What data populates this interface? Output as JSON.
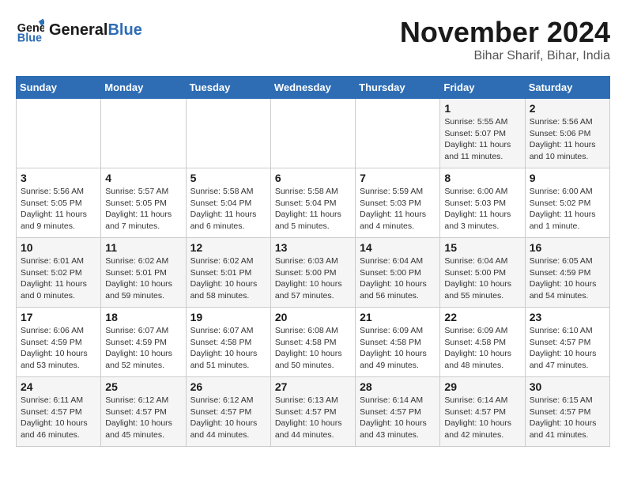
{
  "header": {
    "logo_line1": "General",
    "logo_line2": "Blue",
    "month_title": "November 2024",
    "location": "Bihar Sharif, Bihar, India"
  },
  "weekdays": [
    "Sunday",
    "Monday",
    "Tuesday",
    "Wednesday",
    "Thursday",
    "Friday",
    "Saturday"
  ],
  "weeks": [
    [
      {
        "day": "",
        "detail": ""
      },
      {
        "day": "",
        "detail": ""
      },
      {
        "day": "",
        "detail": ""
      },
      {
        "day": "",
        "detail": ""
      },
      {
        "day": "",
        "detail": ""
      },
      {
        "day": "1",
        "detail": "Sunrise: 5:55 AM\nSunset: 5:07 PM\nDaylight: 11 hours and 11 minutes."
      },
      {
        "day": "2",
        "detail": "Sunrise: 5:56 AM\nSunset: 5:06 PM\nDaylight: 11 hours and 10 minutes."
      }
    ],
    [
      {
        "day": "3",
        "detail": "Sunrise: 5:56 AM\nSunset: 5:05 PM\nDaylight: 11 hours and 9 minutes."
      },
      {
        "day": "4",
        "detail": "Sunrise: 5:57 AM\nSunset: 5:05 PM\nDaylight: 11 hours and 7 minutes."
      },
      {
        "day": "5",
        "detail": "Sunrise: 5:58 AM\nSunset: 5:04 PM\nDaylight: 11 hours and 6 minutes."
      },
      {
        "day": "6",
        "detail": "Sunrise: 5:58 AM\nSunset: 5:04 PM\nDaylight: 11 hours and 5 minutes."
      },
      {
        "day": "7",
        "detail": "Sunrise: 5:59 AM\nSunset: 5:03 PM\nDaylight: 11 hours and 4 minutes."
      },
      {
        "day": "8",
        "detail": "Sunrise: 6:00 AM\nSunset: 5:03 PM\nDaylight: 11 hours and 3 minutes."
      },
      {
        "day": "9",
        "detail": "Sunrise: 6:00 AM\nSunset: 5:02 PM\nDaylight: 11 hours and 1 minute."
      }
    ],
    [
      {
        "day": "10",
        "detail": "Sunrise: 6:01 AM\nSunset: 5:02 PM\nDaylight: 11 hours and 0 minutes."
      },
      {
        "day": "11",
        "detail": "Sunrise: 6:02 AM\nSunset: 5:01 PM\nDaylight: 10 hours and 59 minutes."
      },
      {
        "day": "12",
        "detail": "Sunrise: 6:02 AM\nSunset: 5:01 PM\nDaylight: 10 hours and 58 minutes."
      },
      {
        "day": "13",
        "detail": "Sunrise: 6:03 AM\nSunset: 5:00 PM\nDaylight: 10 hours and 57 minutes."
      },
      {
        "day": "14",
        "detail": "Sunrise: 6:04 AM\nSunset: 5:00 PM\nDaylight: 10 hours and 56 minutes."
      },
      {
        "day": "15",
        "detail": "Sunrise: 6:04 AM\nSunset: 5:00 PM\nDaylight: 10 hours and 55 minutes."
      },
      {
        "day": "16",
        "detail": "Sunrise: 6:05 AM\nSunset: 4:59 PM\nDaylight: 10 hours and 54 minutes."
      }
    ],
    [
      {
        "day": "17",
        "detail": "Sunrise: 6:06 AM\nSunset: 4:59 PM\nDaylight: 10 hours and 53 minutes."
      },
      {
        "day": "18",
        "detail": "Sunrise: 6:07 AM\nSunset: 4:59 PM\nDaylight: 10 hours and 52 minutes."
      },
      {
        "day": "19",
        "detail": "Sunrise: 6:07 AM\nSunset: 4:58 PM\nDaylight: 10 hours and 51 minutes."
      },
      {
        "day": "20",
        "detail": "Sunrise: 6:08 AM\nSunset: 4:58 PM\nDaylight: 10 hours and 50 minutes."
      },
      {
        "day": "21",
        "detail": "Sunrise: 6:09 AM\nSunset: 4:58 PM\nDaylight: 10 hours and 49 minutes."
      },
      {
        "day": "22",
        "detail": "Sunrise: 6:09 AM\nSunset: 4:58 PM\nDaylight: 10 hours and 48 minutes."
      },
      {
        "day": "23",
        "detail": "Sunrise: 6:10 AM\nSunset: 4:57 PM\nDaylight: 10 hours and 47 minutes."
      }
    ],
    [
      {
        "day": "24",
        "detail": "Sunrise: 6:11 AM\nSunset: 4:57 PM\nDaylight: 10 hours and 46 minutes."
      },
      {
        "day": "25",
        "detail": "Sunrise: 6:12 AM\nSunset: 4:57 PM\nDaylight: 10 hours and 45 minutes."
      },
      {
        "day": "26",
        "detail": "Sunrise: 6:12 AM\nSunset: 4:57 PM\nDaylight: 10 hours and 44 minutes."
      },
      {
        "day": "27",
        "detail": "Sunrise: 6:13 AM\nSunset: 4:57 PM\nDaylight: 10 hours and 44 minutes."
      },
      {
        "day": "28",
        "detail": "Sunrise: 6:14 AM\nSunset: 4:57 PM\nDaylight: 10 hours and 43 minutes."
      },
      {
        "day": "29",
        "detail": "Sunrise: 6:14 AM\nSunset: 4:57 PM\nDaylight: 10 hours and 42 minutes."
      },
      {
        "day": "30",
        "detail": "Sunrise: 6:15 AM\nSunset: 4:57 PM\nDaylight: 10 hours and 41 minutes."
      }
    ]
  ]
}
